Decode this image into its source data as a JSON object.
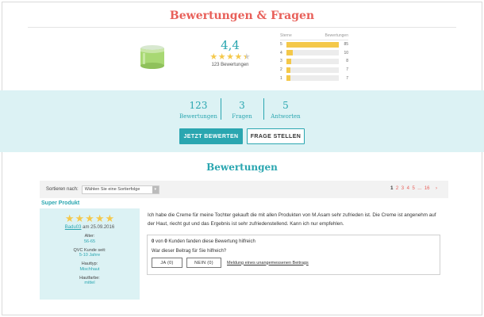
{
  "header": {
    "title": "Bewertungen & Fragen"
  },
  "summary": {
    "average": "4,4",
    "average_value": 4.4,
    "review_count_label": "123 Bewertungen",
    "distribution": {
      "col_stars": "Sterne",
      "col_reviews": "Bewertungen",
      "rows": [
        {
          "stars": "5",
          "count": "85",
          "value": 85
        },
        {
          "stars": "4",
          "count": "10",
          "value": 10
        },
        {
          "stars": "3",
          "count": "8",
          "value": 8
        },
        {
          "stars": "2",
          "count": "7",
          "value": 7
        },
        {
          "stars": "1",
          "count": "7",
          "value": 7
        }
      ]
    },
    "colors": {
      "accent": "#2aa6b0",
      "title": "#e8605a",
      "star": "#f4c84a",
      "star_empty": "#cccccc"
    }
  },
  "stats": [
    {
      "number": "123",
      "label": "Bewertungen"
    },
    {
      "number": "3",
      "label": "Fragen"
    },
    {
      "number": "5",
      "label": "Antworten"
    }
  ],
  "actions": {
    "rate_label": "JETZT BEWERTEN",
    "ask_label": "FRAGE STELLEN"
  },
  "reviews_section": {
    "title": "Bewertungen",
    "sort_label": "Sortieren nach:",
    "sort_placeholder": "Wählen Sie eine Sortierfolge",
    "pagination": [
      "1",
      "2",
      "3",
      "4",
      "5",
      "...",
      "16"
    ],
    "next_icon": "chevron-right-icon"
  },
  "review": {
    "title": "Super Produkt",
    "rating": 5,
    "author": "Badu03",
    "date_prefix": "am 25.09.2016",
    "meta": [
      {
        "label": "Alter:",
        "value": "56-65"
      },
      {
        "label": "QVC Kunde seit:",
        "value": "5-10 Jahre"
      },
      {
        "label": "Hauttyp:",
        "value": "Mischhaut"
      },
      {
        "label": "Hautfarbe:",
        "value": "mittel"
      }
    ],
    "text": "Ich habe die Creme für meine Tochter gekauft die mit allen Produkten von M.Asam sehr zufrieden ist. Die Creme ist angenehm auf der Haut, riecht gut und das Ergebnis ist sehr zufriedenstellend. Kann ich nur empfehlen.",
    "helpful": {
      "helpful_count": "0",
      "total_count": "0",
      "sentence_mid": "von",
      "sentence_end": "Kunden fanden diese Bewertung hilfreich",
      "question": "War dieser Beitrag für Sie hilfreich?",
      "yes_label": "JA (0)",
      "no_label": "NEIN (0)",
      "report_label": "Meldung eines unangemessenen Beitrags"
    }
  }
}
